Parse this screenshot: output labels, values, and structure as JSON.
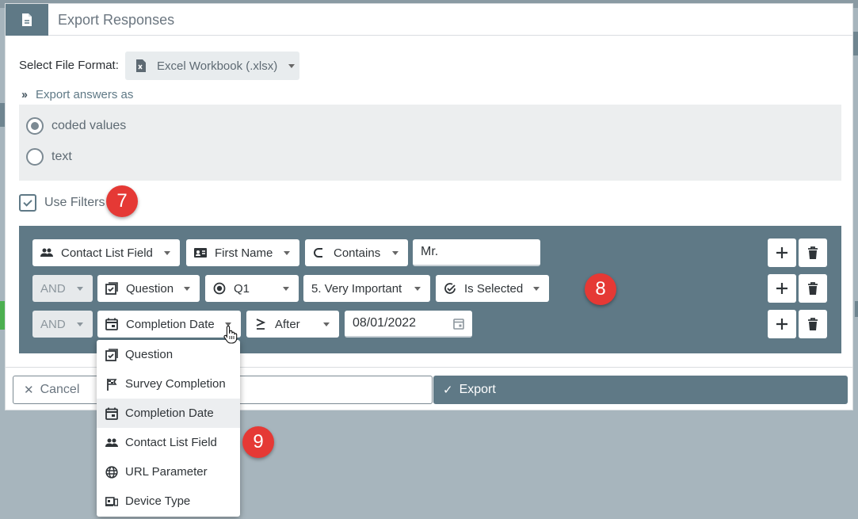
{
  "dialog": {
    "title": "Export Responses",
    "title_icon": "file-icon"
  },
  "file_format": {
    "label": "Select File Format:",
    "selected": "Excel Workbook (.xlsx)",
    "icon": "excel-file-icon"
  },
  "export_as": {
    "label": "Export answers as",
    "options": [
      {
        "label": "coded values",
        "selected": true
      },
      {
        "label": "text",
        "selected": false
      }
    ]
  },
  "use_filters": {
    "label": "Use Filters",
    "checked": true
  },
  "filters": {
    "rows": [
      {
        "connector": "",
        "field": "Contact List Field",
        "field_icon": "contacts-icon",
        "sub_field": "First Name",
        "sub_field_icon": "id-card-icon",
        "operator": "Contains",
        "operator_icon": "contains-icon",
        "value": "Mr."
      },
      {
        "connector": "AND",
        "field": "Question",
        "field_icon": "question-checklist-icon",
        "sub_field": "Q1",
        "sub_field_icon": "radio-dot-icon",
        "option": "5. Very Important",
        "operator": "Is Selected",
        "operator_icon": "check-circle-icon"
      },
      {
        "connector": "AND",
        "field": "Completion Date",
        "field_icon": "calendar-icon",
        "operator": "After",
        "operator_icon": "greater-equal-icon",
        "value": "08/01/2022"
      }
    ]
  },
  "field_dropdown": {
    "items": [
      {
        "label": "Question",
        "icon": "question-checklist-icon"
      },
      {
        "label": "Survey Completion",
        "icon": "flag-icon"
      },
      {
        "label": "Completion Date",
        "icon": "calendar-icon",
        "highlighted": true
      },
      {
        "label": "Contact List Field",
        "icon": "contacts-icon"
      },
      {
        "label": "URL Parameter",
        "icon": "globe-icon"
      },
      {
        "label": "Device Type",
        "icon": "devices-icon"
      }
    ]
  },
  "footer": {
    "cancel_label": "Cancel",
    "export_label": "Export"
  },
  "badges": [
    "7",
    "8",
    "9"
  ],
  "colors": {
    "primary": "#5f7986",
    "badge": "#e53935",
    "panel": "#eceeef"
  }
}
